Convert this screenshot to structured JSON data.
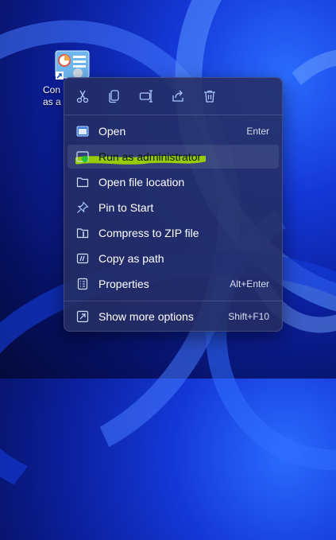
{
  "desktop": {
    "shortcut_label": "Con\nas a"
  },
  "context_menu": {
    "toolbar": [
      {
        "name": "cut",
        "icon": "scissors-icon"
      },
      {
        "name": "copy",
        "icon": "copy-icon"
      },
      {
        "name": "rename",
        "icon": "rename-icon"
      },
      {
        "name": "share",
        "icon": "share-icon"
      },
      {
        "name": "delete",
        "icon": "trash-icon"
      }
    ],
    "items": [
      {
        "label": "Open",
        "shortcut": "Enter",
        "icon": "open-window-icon"
      },
      {
        "label": "Run as administrator",
        "shortcut": "",
        "icon": "admin-shield-icon",
        "highlighted": true
      },
      {
        "label": "Open file location",
        "shortcut": "",
        "icon": "folder-icon"
      },
      {
        "label": "Pin to Start",
        "shortcut": "",
        "icon": "pin-icon"
      },
      {
        "label": "Compress to ZIP file",
        "shortcut": "",
        "icon": "zip-folder-icon"
      },
      {
        "label": "Copy as path",
        "shortcut": "",
        "icon": "copy-path-icon"
      },
      {
        "label": "Properties",
        "shortcut": "Alt+Enter",
        "icon": "properties-icon"
      },
      {
        "label": "Show more options",
        "shortcut": "Shift+F10",
        "icon": "more-options-icon"
      }
    ],
    "highlight_color": "#9bd400"
  }
}
